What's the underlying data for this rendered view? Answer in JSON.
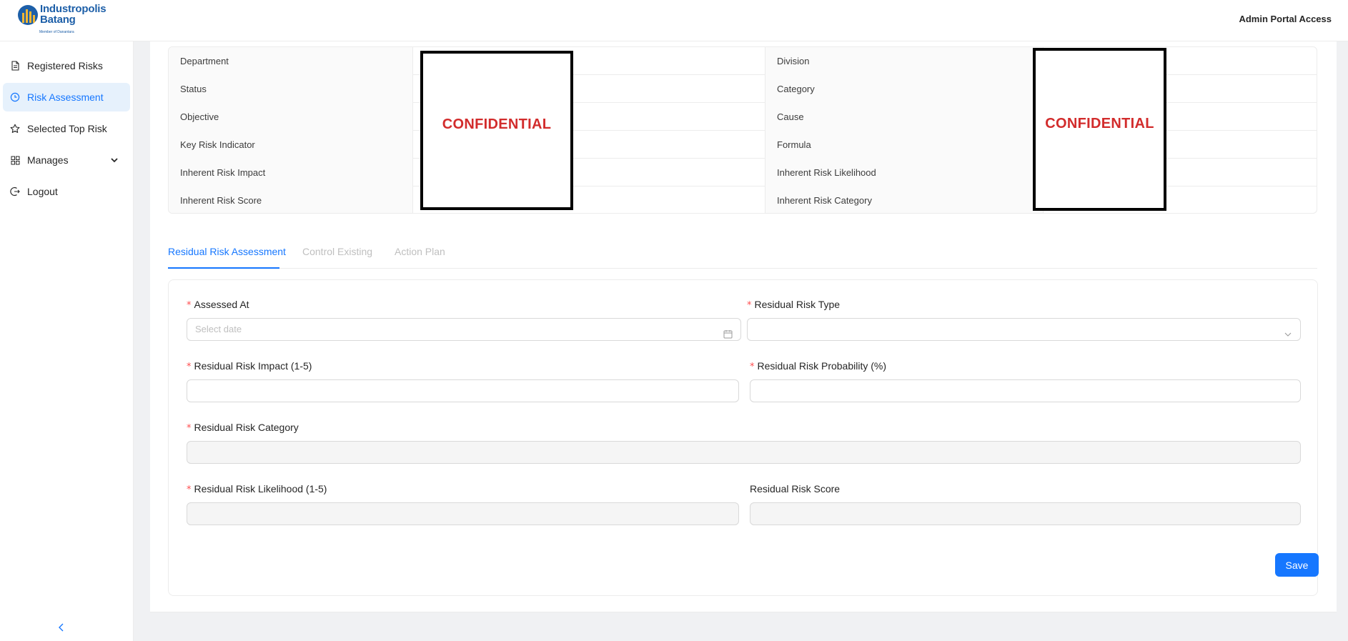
{
  "header": {
    "logo_line1": "Industropolis",
    "logo_line2": "Batang",
    "logo_sub": "Member of Danantara",
    "portal_label": "Admin Portal Access"
  },
  "sidebar": {
    "items": [
      {
        "label": "Registered Risks",
        "icon": "document-icon"
      },
      {
        "label": "Risk Assessment",
        "icon": "clock-icon"
      },
      {
        "label": "Selected Top Risk",
        "icon": "star-icon"
      },
      {
        "label": "Manages",
        "icon": "grid-icon"
      },
      {
        "label": "Logout",
        "icon": "logout-icon"
      }
    ],
    "active": "Risk Assessment"
  },
  "info": {
    "left_labels": [
      "Department",
      "Status",
      "Objective",
      "Key Risk Indicator",
      "Inherent Risk Impact",
      "Inherent Risk Score"
    ],
    "right_labels": [
      "Division",
      "Category",
      "Cause",
      "Formula",
      "Inherent Risk Likelihood",
      "Inherent Risk Category"
    ],
    "redaction_text": "CONFIDENTIAL"
  },
  "tabs": [
    {
      "label": "Residual Risk Assessment",
      "active": true
    },
    {
      "label": "Control Existing",
      "active": false
    },
    {
      "label": "Action Plan",
      "active": false
    }
  ],
  "form": {
    "assessed_at": {
      "label": "Assessed At",
      "placeholder": "Select date"
    },
    "residual_type": {
      "label": "Residual Risk Type"
    },
    "impact": {
      "label": "Residual Risk Impact (1-5)"
    },
    "probability": {
      "label": "Residual Risk Probability (%)"
    },
    "category": {
      "label": "Residual Risk Category"
    },
    "likelihood": {
      "label": "Residual Risk Likelihood (1-5)"
    },
    "score": {
      "label": "Residual Risk Score"
    },
    "required_mark": "*",
    "save_label": "Save"
  },
  "colors": {
    "primary": "#1677ff",
    "active_bg": "#e6f1fc",
    "redaction": "#d22c2c",
    "brand": "#1d5fa8"
  }
}
